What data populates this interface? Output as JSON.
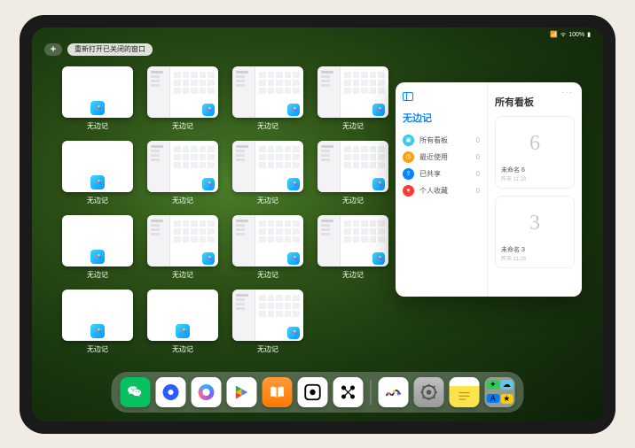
{
  "status": {
    "battery": "100%"
  },
  "topbar": {
    "plus": "+",
    "reopen_label": "重新打开已关闭的窗口"
  },
  "tile_label": "无边记",
  "panel": {
    "left_title": "无边记",
    "right_title": "所有看板",
    "more": "···",
    "nav": [
      {
        "label": "所有看板",
        "count": 0
      },
      {
        "label": "最近使用",
        "count": 0
      },
      {
        "label": "已共享",
        "count": 0
      },
      {
        "label": "个人收藏",
        "count": 0
      }
    ],
    "cards": [
      {
        "sketch": "6",
        "label": "未命名 6",
        "sub": "昨天 11:28"
      },
      {
        "sketch": "3",
        "label": "未命名 3",
        "sub": "昨天 11:25"
      }
    ]
  },
  "dock": {
    "items": [
      {
        "name": "wechat-icon"
      },
      {
        "name": "browser1-icon"
      },
      {
        "name": "browser2-icon"
      },
      {
        "name": "play-icon"
      },
      {
        "name": "books-icon"
      },
      {
        "name": "dice-icon"
      },
      {
        "name": "connect-icon"
      },
      {
        "name": "freeform-icon"
      },
      {
        "name": "settings-icon"
      },
      {
        "name": "notes-icon"
      },
      {
        "name": "applibrary-icon"
      }
    ]
  },
  "thumb_variants": [
    "blank",
    "cal",
    "cal",
    "cal",
    "blank",
    "cal",
    "cal",
    "cal",
    "blank",
    "cal",
    "cal",
    "cal",
    "blank",
    "blank",
    "cal"
  ]
}
